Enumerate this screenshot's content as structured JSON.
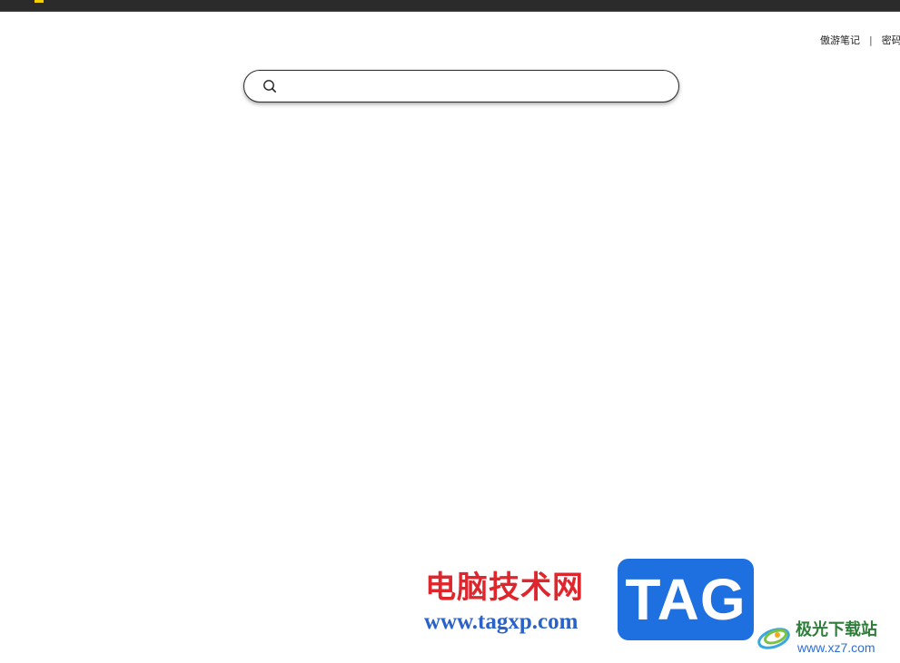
{
  "top_links": {
    "notes": "傲游笔记",
    "separator": "|",
    "password": "密码"
  },
  "search": {
    "placeholder": "",
    "value": ""
  },
  "watermark": {
    "title": "电脑技术网",
    "url": "www.tagxp.com",
    "tag": "TAG",
    "site_name": "极光下载站",
    "site_url": "www.xz7.com"
  },
  "icons": {
    "search": "search-icon",
    "logo": "aurora-logo-icon"
  },
  "colors": {
    "watermark_red": "#e0262d",
    "watermark_blue": "#2a62c8",
    "tag_bg": "#1e6fe0",
    "site_green": "#2f7d3a"
  }
}
